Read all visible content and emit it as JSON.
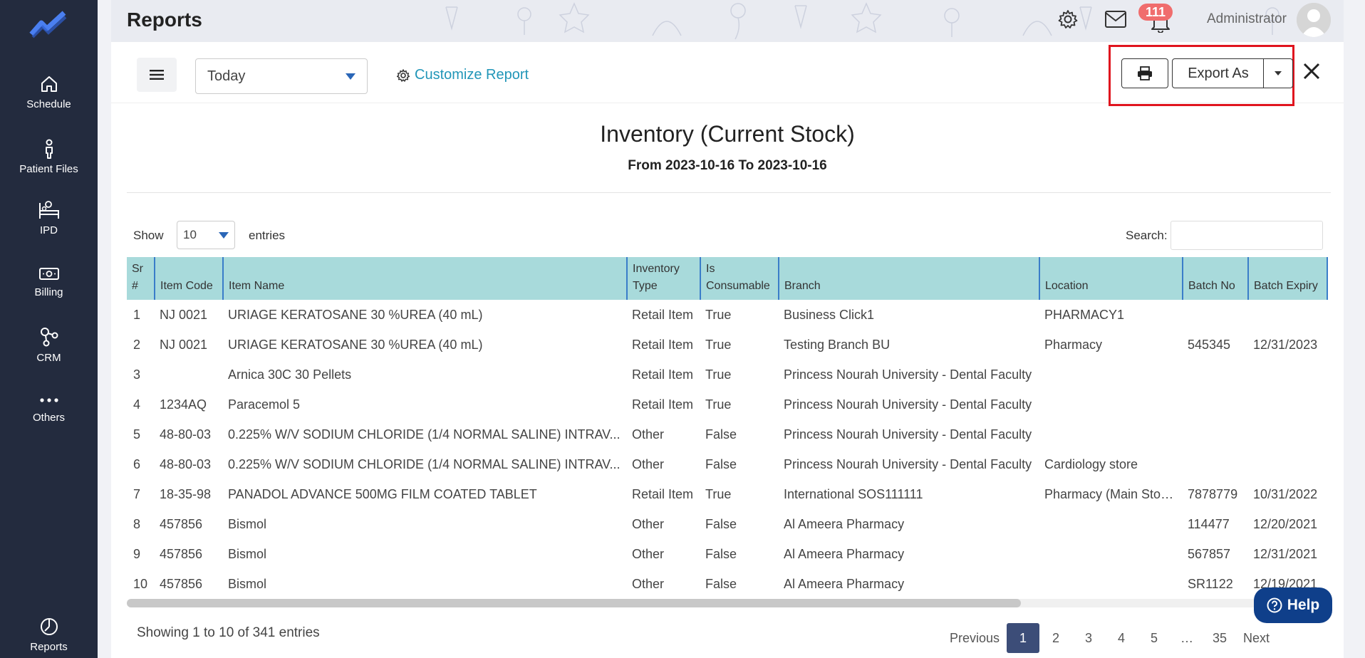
{
  "sidebar": {
    "items": [
      {
        "label": "Schedule",
        "icon": "home-icon"
      },
      {
        "label": "Patient Files",
        "icon": "patient-icon"
      },
      {
        "label": "IPD",
        "icon": "bed-icon"
      },
      {
        "label": "Billing",
        "icon": "cash-icon"
      },
      {
        "label": "CRM",
        "icon": "network-icon"
      },
      {
        "label": "Others",
        "icon": "more-dots-icon"
      },
      {
        "label": "Reports",
        "icon": "pie-chart-icon"
      }
    ]
  },
  "header": {
    "title": "Reports",
    "notification_count": "111",
    "user_name": "Administrator"
  },
  "toolbar": {
    "date_range": "Today",
    "customize_label": "Customize Report",
    "export_label": "Export As"
  },
  "report": {
    "title": "Inventory (Current Stock)",
    "range": "From 2023-10-16 To 2023-10-16"
  },
  "table_controls": {
    "show_label": "Show",
    "page_length": "10",
    "entries_label": "entries",
    "search_label": "Search:",
    "search_value": ""
  },
  "table": {
    "columns": [
      "Sr #",
      "Item Code",
      "Item Name",
      "Inventory Type",
      "Is Consumable",
      "Branch",
      "Location",
      "Batch No",
      "Batch Expiry"
    ],
    "rows": [
      [
        "1",
        "NJ 0021",
        "URIAGE KERATOSANE 30 %UREA (40 mL)",
        "Retail Item",
        "True",
        "Business Click1",
        "PHARMACY1",
        "",
        ""
      ],
      [
        "2",
        "NJ 0021",
        "URIAGE KERATOSANE 30 %UREA (40 mL)",
        "Retail Item",
        "True",
        "Testing Branch BU",
        "Pharmacy",
        "545345",
        "12/31/2023"
      ],
      [
        "3",
        "",
        "Arnica 30C 30 Pellets",
        "Retail Item",
        "True",
        "Princess Nourah University - Dental Faculty",
        "",
        "",
        ""
      ],
      [
        "4",
        "1234AQ",
        "Paracemol 5",
        "Retail Item",
        "True",
        "Princess Nourah University - Dental Faculty",
        "",
        "",
        ""
      ],
      [
        "5",
        "48-80-03",
        "0.225% W/V SODIUM CHLORIDE (1/4 NORMAL SALINE) INTRAV...",
        "Other",
        "False",
        "Princess Nourah University - Dental Faculty",
        "",
        "",
        ""
      ],
      [
        "6",
        "48-80-03",
        "0.225% W/V SODIUM CHLORIDE (1/4 NORMAL SALINE) INTRAV...",
        "Other",
        "False",
        "Princess Nourah University - Dental Faculty",
        "Cardiology store",
        "",
        ""
      ],
      [
        "7",
        "18-35-98",
        "PANADOL ADVANCE 500MG FILM COATED TABLET",
        "Retail Item",
        "True",
        "International SOS111111",
        "Pharmacy (Main Stock)",
        "7878779",
        "10/31/2022"
      ],
      [
        "8",
        "457856",
        "Bismol",
        "Other",
        "False",
        "Al Ameera Pharmacy",
        "",
        "114477",
        "12/20/2021"
      ],
      [
        "9",
        "457856",
        "Bismol",
        "Other",
        "False",
        "Al Ameera Pharmacy",
        "",
        "567857",
        "12/31/2021"
      ],
      [
        "10",
        "457856",
        "Bismol",
        "Other",
        "False",
        "Al Ameera Pharmacy",
        "",
        "SR1122",
        "12/19/2021"
      ]
    ]
  },
  "help_label": "Help",
  "pagination": {
    "info": "Showing 1 to 10 of 341 entries",
    "previous": "Previous",
    "pages": [
      "1",
      "2",
      "3",
      "4",
      "5",
      "…",
      "35"
    ],
    "active_page": "1",
    "next": "Next"
  },
  "colors": {
    "sidebar_bg": "#232b3e",
    "table_header_bg": "#a8dadb",
    "accent_link": "#2196b8",
    "active_page_bg": "#3c4d78",
    "help_bg": "#0f3f8a",
    "highlight_box": "#e0141e",
    "badge_bg": "#f06d6d"
  }
}
